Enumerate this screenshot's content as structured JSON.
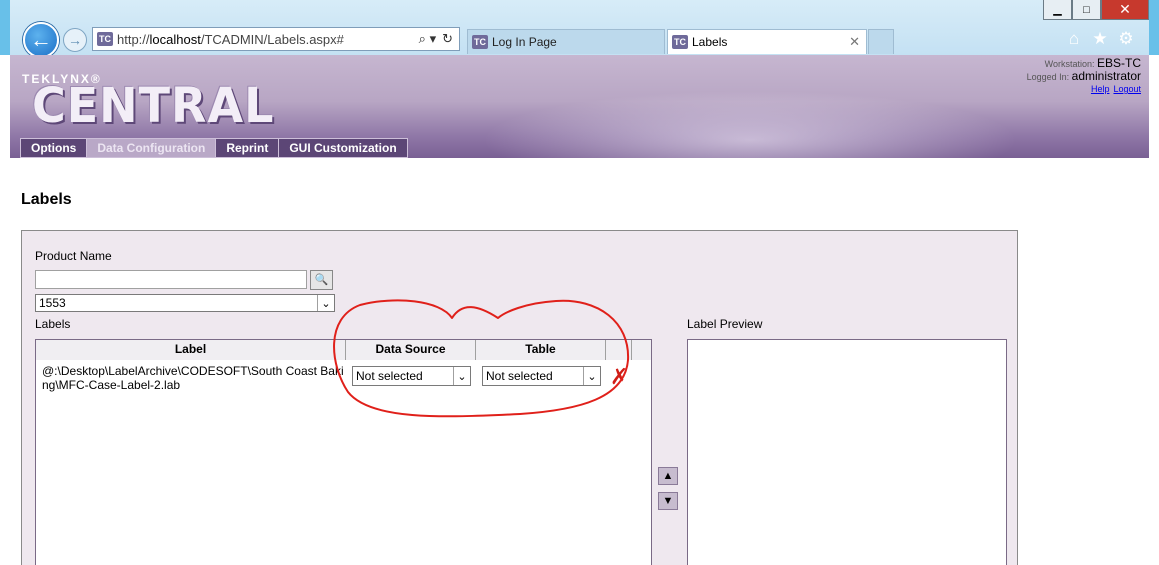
{
  "browser": {
    "address": {
      "prefix": "http://",
      "host": "localhost",
      "path": "/TCADMIN/Labels.aspx#",
      "favicon": "TC"
    },
    "tabs": [
      {
        "label": "Log In Page",
        "favicon": "TC",
        "active": false
      },
      {
        "label": "Labels",
        "favicon": "TC",
        "active": true
      }
    ],
    "icons": {
      "minimize": "minimize-icon",
      "maximize": "maximize-icon",
      "close": "close-icon",
      "back": "back-arrow-icon",
      "forward": "forward-arrow-icon",
      "search": "search-icon",
      "refresh": "refresh-icon",
      "home": "home-icon",
      "favorites": "star-icon",
      "settings": "gear-icon"
    },
    "colors": {
      "frame": "#68c0e9",
      "close": "#c7392d"
    }
  },
  "header": {
    "brand_small": "TEKLYNX®",
    "brand_big": "CENTRAL",
    "workstation_label": "Workstation:",
    "workstation_value": "EBS-TC",
    "logged_in_label": "Logged In:",
    "logged_in_value": "administrator",
    "help_link": "Help",
    "logout_link": "Logout"
  },
  "menu": {
    "items": [
      {
        "label": "Options",
        "selected": false
      },
      {
        "label": "Data Configuration",
        "selected": true
      },
      {
        "label": "Reprint",
        "selected": false
      },
      {
        "label": "GUI Customization",
        "selected": false
      }
    ],
    "colors": {
      "bar": "#5c4676",
      "selected": "#b9a8c7"
    }
  },
  "main": {
    "title": "Labels",
    "product_name_label": "Product Name",
    "product_name_value": "",
    "product_select_value": "1553",
    "labels_section_label": "Labels",
    "label_preview_label": "Label Preview",
    "grid": {
      "columns": [
        "Label",
        "Data Source",
        "Table"
      ],
      "rows": [
        {
          "label": "@:\\Desktop\\LabelArchive\\CODESOFT\\South Coast Baking\\MFC-Case-Label-2.lab",
          "data_source": "Not selected",
          "table": "Not selected"
        }
      ]
    },
    "move_up_glyph": "▲",
    "move_down_glyph": "▼",
    "colors": {
      "panel": "#efe8ef",
      "delete": "#d01d16",
      "annotation": "#e0201a"
    }
  }
}
